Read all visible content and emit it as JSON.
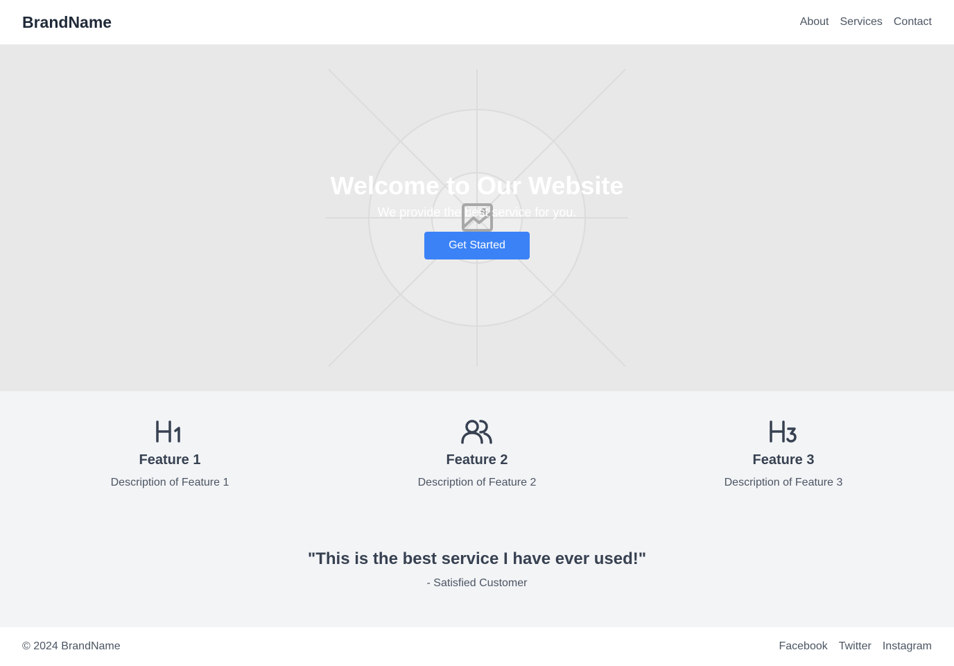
{
  "header": {
    "brand": "BrandName",
    "nav": [
      "About",
      "Services",
      "Contact"
    ]
  },
  "hero": {
    "title": "Welcome to Our Website",
    "subtitle": "We provide the best service for you.",
    "cta_label": "Get Started",
    "background_icon": "image-placeholder-icon"
  },
  "features": [
    {
      "icon": "heading-1-icon",
      "title": "Feature 1",
      "description": "Description of Feature 1"
    },
    {
      "icon": "users-icon",
      "title": "Feature 2",
      "description": "Description of Feature 2"
    },
    {
      "icon": "heading-3-icon",
      "title": "Feature 3",
      "description": "Description of Feature 3"
    }
  ],
  "testimonial": {
    "quote": "\"This is the best service I have ever used!\"",
    "author": "- Satisfied Customer"
  },
  "footer": {
    "copyright": "© 2024 BrandName",
    "social": [
      "Facebook",
      "Twitter",
      "Instagram"
    ]
  },
  "colors": {
    "accent": "#3b82f6",
    "hero_bg": "#e8e8e8",
    "section_bg": "#f3f4f6",
    "text_dark": "#1f2937"
  }
}
